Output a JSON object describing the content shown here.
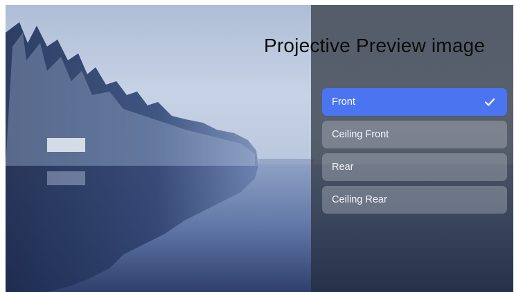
{
  "title": "Projective Preview image",
  "options": [
    {
      "label": "Front",
      "selected": true
    },
    {
      "label": "Ceiling Front",
      "selected": false
    },
    {
      "label": "Rear",
      "selected": false
    },
    {
      "label": "Ceiling Rear",
      "selected": false
    }
  ],
  "colors": {
    "accent": "#4a74f0",
    "option_bg": "rgba(200,205,215,0.33)",
    "panel_bg": "#464c58"
  },
  "icons": {
    "selected": "check-icon"
  }
}
